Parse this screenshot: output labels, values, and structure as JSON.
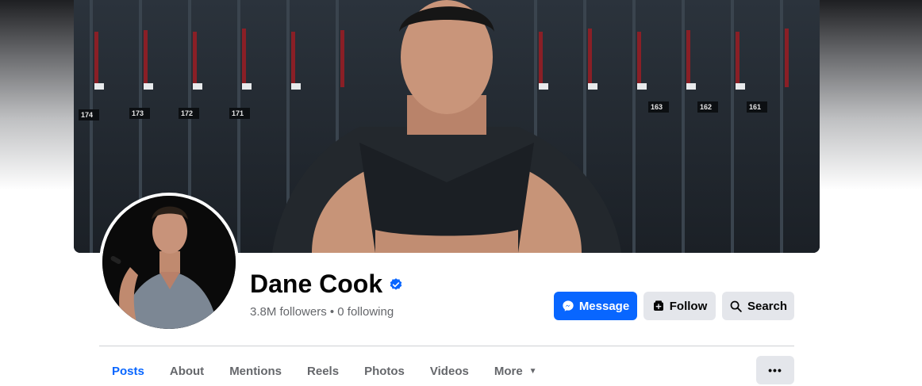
{
  "profile": {
    "name": "Dane Cook",
    "followers_text": "3.8M followers • 0 following"
  },
  "actions": {
    "message_label": "Message",
    "follow_label": "Follow",
    "search_label": "Search"
  },
  "tabs": [
    {
      "label": "Posts",
      "active": true
    },
    {
      "label": "About"
    },
    {
      "label": "Mentions"
    },
    {
      "label": "Reels"
    },
    {
      "label": "Photos"
    },
    {
      "label": "Videos"
    },
    {
      "label": "More"
    }
  ],
  "cover_locker_numbers": [
    "174",
    "173",
    "172",
    "171",
    "163",
    "162",
    "161"
  ],
  "colors": {
    "accent": "#0866ff",
    "secondary_button": "#e4e6eb",
    "muted_text": "#65676b",
    "verified": "#0866ff"
  },
  "icons": {
    "verified": "verified-badge-icon",
    "message": "messenger-icon",
    "follow": "follow-icon",
    "search": "search-icon",
    "more_caret": "caret-down-icon",
    "overflow": "ellipsis-icon"
  }
}
